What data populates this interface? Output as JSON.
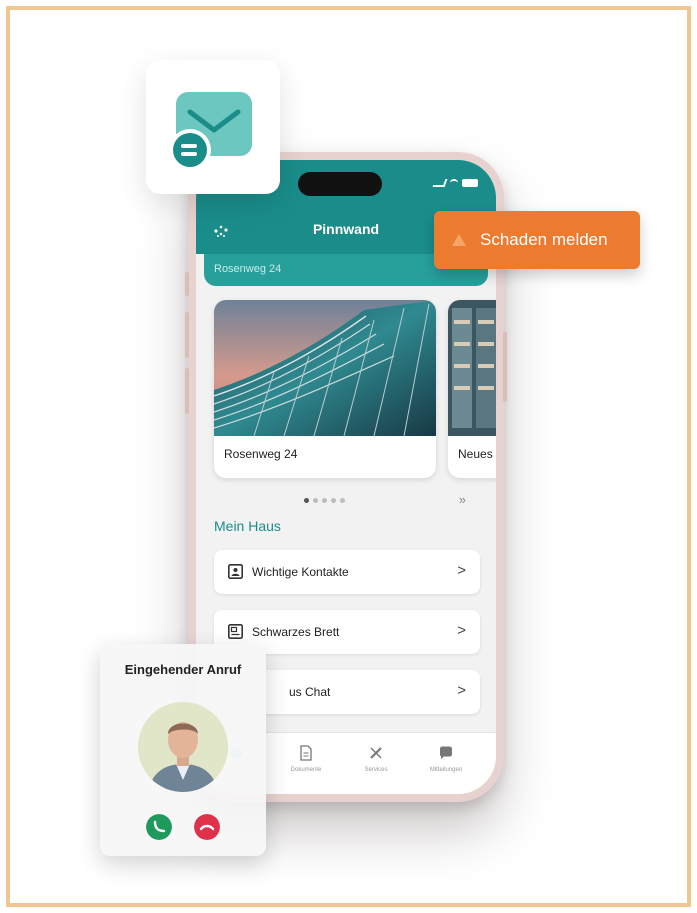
{
  "phone": {
    "appbar": {
      "title": "Pinnwand",
      "menu_icon": "sparkle-icon"
    },
    "address": "Rosenweg 24",
    "cards": [
      {
        "label": "Rosenweg 24"
      },
      {
        "label": "Neues"
      }
    ],
    "carousel": {
      "dots": 5,
      "active_index": 0,
      "next_symbol": "»"
    },
    "section_title": "Mein Haus",
    "list": [
      {
        "label": "Wichtige Kontakte",
        "icon": "contact-card-icon"
      },
      {
        "label": "Schwarzes Brett",
        "icon": "board-icon"
      },
      {
        "label": "Haus Chat",
        "visible_label": "us Chat",
        "icon": "chat-icon"
      }
    ],
    "chevron": ">",
    "tabs": [
      {
        "label": "",
        "icon": "home-icon"
      },
      {
        "label": "Dokumente",
        "icon": "document-icon"
      },
      {
        "label": "Services",
        "icon": "tools-icon"
      },
      {
        "label": "Mitteilungen",
        "icon": "message-icon"
      }
    ]
  },
  "report_button": {
    "label": "Schaden melden",
    "icon": "warning-icon"
  },
  "call": {
    "title": "Eingehender Anruf",
    "accept_icon": "phone-accept-icon",
    "decline_icon": "phone-decline-icon"
  },
  "colors": {
    "teal": "#1a8d8a",
    "orange": "#ec7a2f",
    "frame": "#efc690",
    "accept": "#1f9a5c",
    "decline": "#e0314a"
  }
}
